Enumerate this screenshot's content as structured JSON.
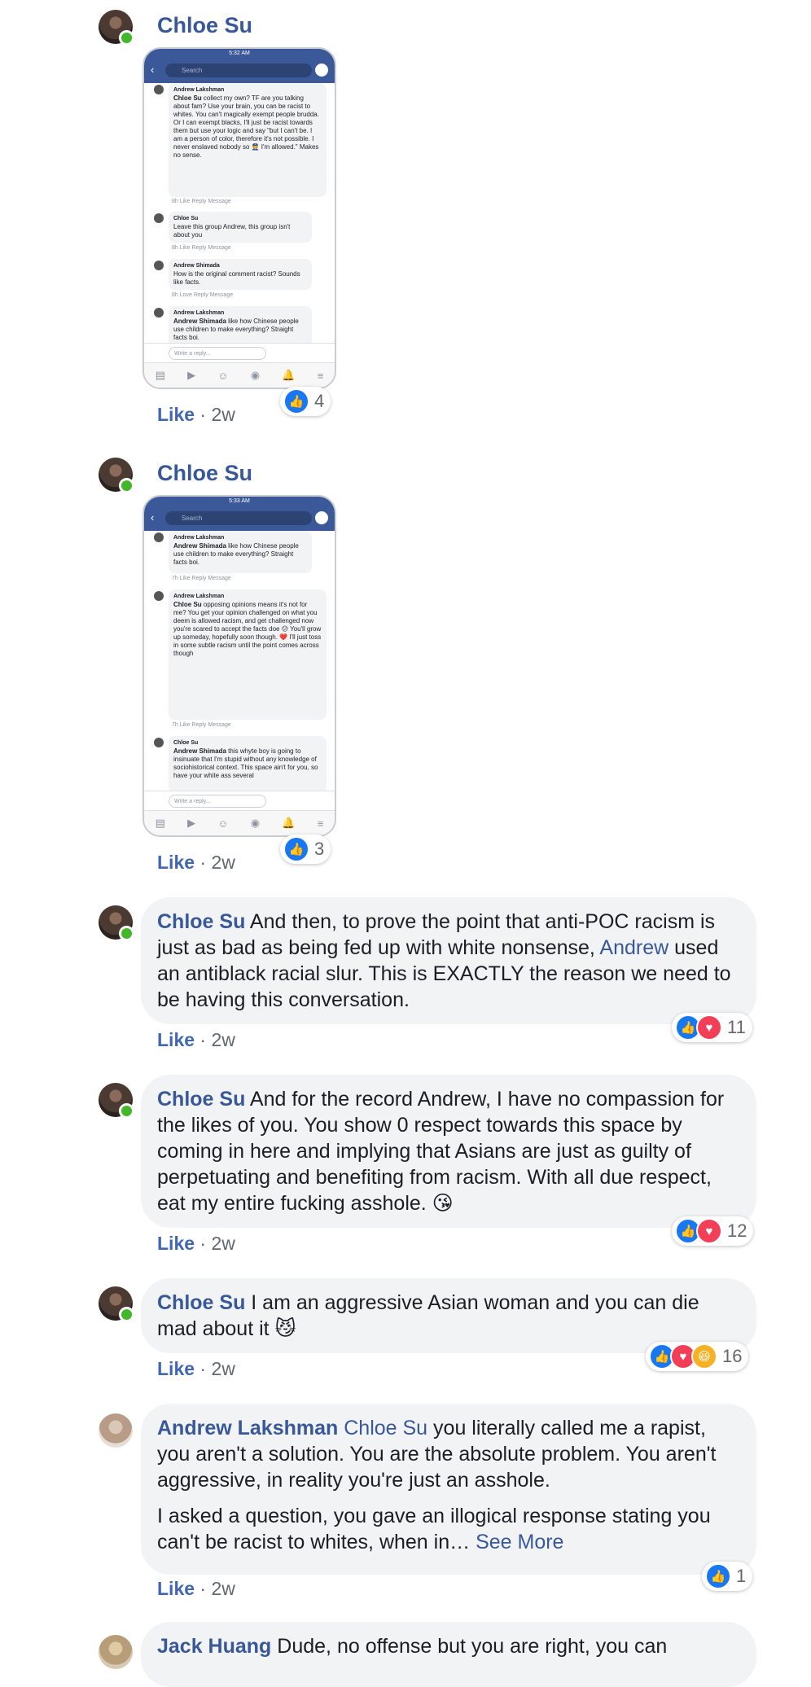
{
  "common": {
    "like_label": "Like",
    "sep": " · ",
    "time": "2w",
    "see_more": "See More"
  },
  "comments": [
    {
      "author": "Chloe Su",
      "type": "image",
      "reaction_count": "4",
      "phone": {
        "status_time": "5:32 AM",
        "search_placeholder": "Search",
        "reply_placeholder": "Write a reply...",
        "items": [
          {
            "author": "Andrew Lakshman",
            "tag": "Chloe Su",
            "text": "collect my own? TF are you talking about fam? Use your brain, you can be racist to whites. You can't magically exempt people brudda. Or I can exempt blacks, I'll just be racist towards them but use your logic and say \"but I can't be. I am a person of color, therefore it's not possible. I never enslaved nobody so 👮 I'm allowed.\" Makes no sense.",
            "actions": "8h   Like   Reply   Message"
          },
          {
            "author": "Chloe Su",
            "tag": "",
            "text": "Leave this group Andrew, this group isn't about you",
            "actions": "8h   Like   Reply   Message"
          },
          {
            "author": "Andrew Shimada",
            "tag": "",
            "text": "How is the original comment racist? Sounds like facts.",
            "actions": "8h   Love   Reply   Message"
          },
          {
            "author": "Andrew Lakshman",
            "tag": "Andrew Shimada",
            "text": "like how Chinese people use children to make everything? Straight facts boi.",
            "actions": ""
          }
        ]
      }
    },
    {
      "author": "Chloe Su",
      "type": "image",
      "reaction_count": "3",
      "phone": {
        "status_time": "5:33 AM",
        "search_placeholder": "Search",
        "reply_placeholder": "Write a reply...",
        "items": [
          {
            "author": "Andrew Lakshman",
            "tag": "Andrew Shimada",
            "text": "like how Chinese people use children to make everything? Straight facts boi.",
            "actions": "7h   Like   Reply   Message"
          },
          {
            "author": "Andrew Lakshman",
            "tag": "Chloe Su",
            "text": "opposing opinions means it's not for me? You get your opinion challenged on what you deem is allowed racism, and get challenged now you're scared to accept the facts doe 😕 You'll grow up someday, hopefully soon though. ❤️ I'll just toss in some subtle racism until the point comes across though",
            "actions": "7h   Like   Reply   Message"
          },
          {
            "author": "Chloe Su",
            "tag": "Andrew Shimada",
            "text": "this whyte boy is going to insinuate that I'm stupid without any knowledge of sociohistorical context. This space ain't for you, so have your white ass several",
            "actions": ""
          }
        ]
      }
    },
    {
      "author": "Chloe Su",
      "type": "text",
      "paragraphs": [
        {
          "before": " And then, to prove the point that anti-POC racism is just as bad as being fed up with white nonsense, ",
          "mention": "Andrew",
          "after": " used an antiblack racial slur. This is EXACTLY the reason we need to be having this conversation."
        }
      ],
      "reaction_count": "11"
    },
    {
      "author": "Chloe Su",
      "type": "text",
      "paragraphs": [
        {
          "before": " And for the record Andrew, I have no compassion for the likes of you. You show 0 respect towards this space by coming in here and implying that Asians are just as guilty of perpetuating and benefiting from racism. With all due respect, eat my entire fucking asshole. 😘",
          "mention": "",
          "after": ""
        }
      ],
      "reaction_count": "12"
    },
    {
      "author": "Chloe Su",
      "type": "text",
      "paragraphs": [
        {
          "before": " I am an aggressive Asian woman and you can die mad about it 😼",
          "mention": "",
          "after": ""
        }
      ],
      "reaction_count": "16"
    },
    {
      "author": "Andrew Lakshman",
      "type": "text",
      "paragraphs": [
        {
          "before": " ",
          "mention": "Chloe Su",
          "after": " you literally called me a rapist, you aren't a solution. You are the absolute problem. You aren't aggressive, in reality you're just an asshole."
        },
        {
          "before": "I asked a question, you gave an illogical response stating you can't be racist to whites, when in… ",
          "mention": "",
          "after": ""
        }
      ],
      "reaction_count": "1"
    },
    {
      "author": "Jack Huang",
      "type": "text",
      "paragraphs": [
        {
          "before": " Dude, no offense but you are right, you can",
          "mention": "",
          "after": ""
        }
      ]
    }
  ]
}
